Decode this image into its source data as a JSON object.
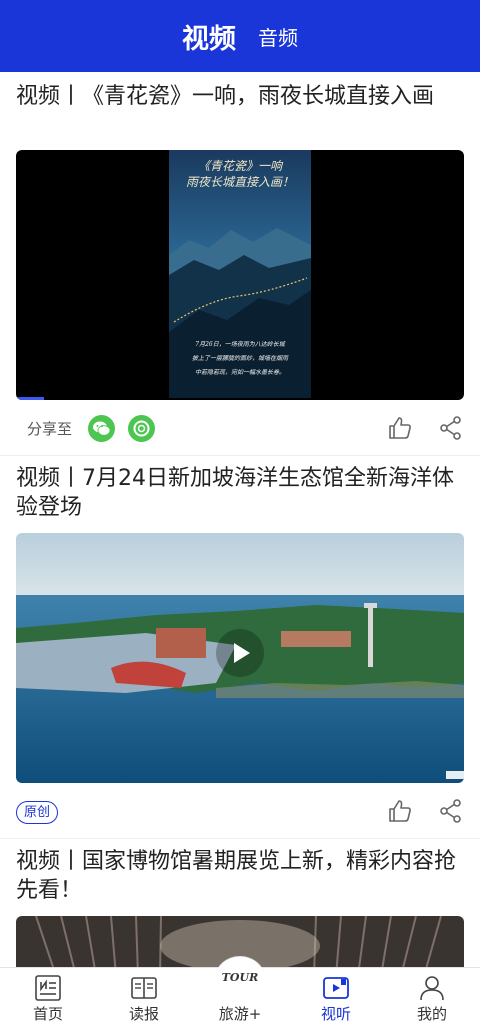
{
  "header": {
    "tabs": [
      {
        "label": "视频",
        "active": true
      },
      {
        "label": "音频",
        "active": false
      }
    ]
  },
  "feed": {
    "items": [
      {
        "title": "视频丨《青花瓷》一响，雨夜长城直接入画",
        "overlay_title": "《青花瓷》一响\n雨夜长城直接入画！",
        "overlay_caption": "7月26日，一场夜雨为八达岭长城\n披上了一层朦胧的面纱，城墙在烟雨\n中若隐若现，宛如一幅水墨长卷。",
        "share_label": "分享至"
      },
      {
        "title": "视频丨7月24日新加坡海洋生态馆全新海洋体验登场",
        "badge": "原创"
      },
      {
        "title": "视频丨国家博物馆暑期展览上新，精彩内容抢先看！"
      }
    ]
  },
  "bottom_nav": {
    "items": [
      {
        "label": "首页"
      },
      {
        "label": "读报"
      },
      {
        "label": "旅游+",
        "logo_text": "TOUR"
      },
      {
        "label": "视听",
        "active": true
      },
      {
        "label": "我的"
      }
    ]
  },
  "colors": {
    "brand": "#1a35d8",
    "share_green": "#4cc551"
  }
}
